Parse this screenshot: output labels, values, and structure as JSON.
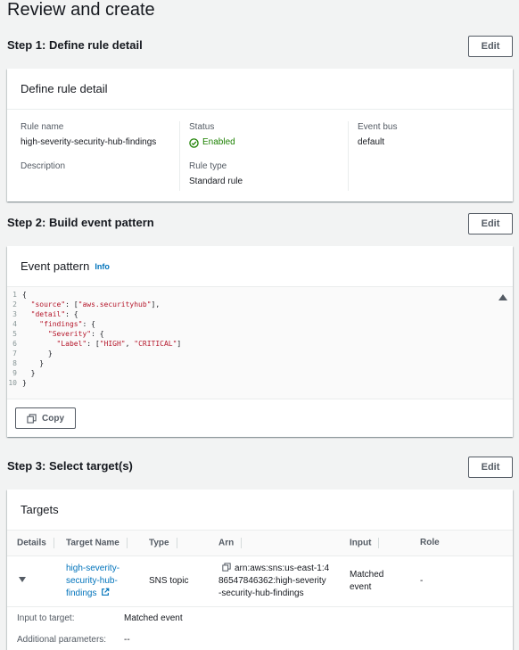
{
  "page_title": "Review and create",
  "edit_label": "Edit",
  "step1": {
    "title": "Step 1: Define rule detail",
    "panel_title": "Define rule detail",
    "rule_name_label": "Rule name",
    "rule_name": "high-severity-security-hub-findings",
    "description_label": "Description",
    "status_label": "Status",
    "status_value": "Enabled",
    "rule_type_label": "Rule type",
    "rule_type_value": "Standard rule",
    "event_bus_label": "Event bus",
    "event_bus_value": "default"
  },
  "step2": {
    "title": "Step 2: Build event pattern",
    "panel_title": "Event pattern",
    "info_label": "Info",
    "copy_label": "Copy",
    "code_lines": [
      "{",
      "  \"source\": [\"aws.securityhub\"],",
      "  \"detail\": {",
      "    \"findings\": {",
      "      \"Severity\": {",
      "        \"Label\": [\"HIGH\", \"CRITICAL\"]",
      "      }",
      "    }",
      "  }",
      "}"
    ]
  },
  "step3": {
    "title": "Step 3: Select target(s)",
    "panel_title": "Targets",
    "columns": [
      "Details",
      "Target Name",
      "Type",
      "Arn",
      "Input",
      "Role"
    ],
    "row": {
      "target_name_lines": [
        "high-severity-",
        "security-hub-",
        "findings"
      ],
      "type": "SNS topic",
      "arn_lines": [
        "arn:aws:sns:us-east-1:4",
        "86547846362:high-severity",
        "-security-hub-findings"
      ],
      "input_lines": [
        "Matched",
        "event"
      ],
      "role": "-"
    },
    "input_to_target_label": "Input to target:",
    "input_to_target_value": "Matched event",
    "additional_params_label": "Additional parameters:",
    "additional_params_value": "--"
  },
  "colors": {
    "link": "#0073bb",
    "success": "#1d8102",
    "background": "#f2f3f3"
  }
}
